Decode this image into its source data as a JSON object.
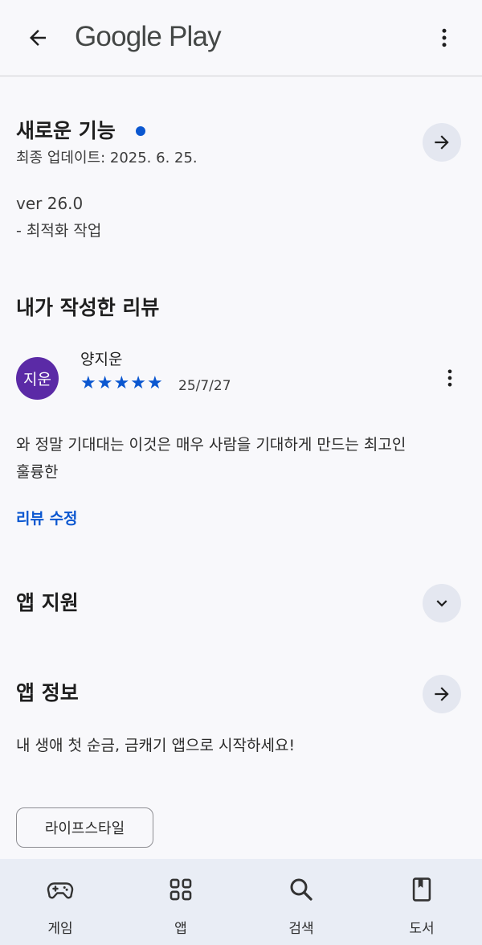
{
  "header": {
    "brand": "Google Play",
    "back_icon": "arrow-left-icon",
    "more_icon": "more-vert-icon"
  },
  "whats_new": {
    "title": "새로운 기능",
    "updated": "최종 업데이트: 2025. 6. 25.",
    "version": "ver 26.0",
    "note": "- 최적화 작업",
    "indicator_color": "#0b57d0"
  },
  "my_review": {
    "title": "내가 작성한 리뷰",
    "avatar_text": "지운",
    "avatar_color": "#5b2aa6",
    "author": "양지운",
    "rating": 5,
    "stars": [
      "★",
      "★",
      "★",
      "★",
      "★"
    ],
    "date": "25/7/27",
    "text_line1": "와 정말 기대대는 이것은 매우 사람을 기대하게 만드는 최고인",
    "text_line2": "훌륭한",
    "edit_label": "리뷰 수정"
  },
  "app_support": {
    "title": "앱 지원"
  },
  "app_info": {
    "title": "앱 정보",
    "description": "내 생애 첫 순금, 금캐기 앱으로 시작하세요!",
    "chip": "라이프스타일"
  },
  "bottom_nav": {
    "items": [
      {
        "label": "게임",
        "icon": "gamepad-icon"
      },
      {
        "label": "앱",
        "icon": "apps-grid-icon"
      },
      {
        "label": "검색",
        "icon": "search-icon"
      },
      {
        "label": "도서",
        "icon": "book-icon"
      }
    ]
  },
  "colors": {
    "accent": "#0b57d0",
    "background": "#f8f8fb",
    "nav_background": "#e9edf5",
    "circle_button": "#e4e7f0"
  }
}
